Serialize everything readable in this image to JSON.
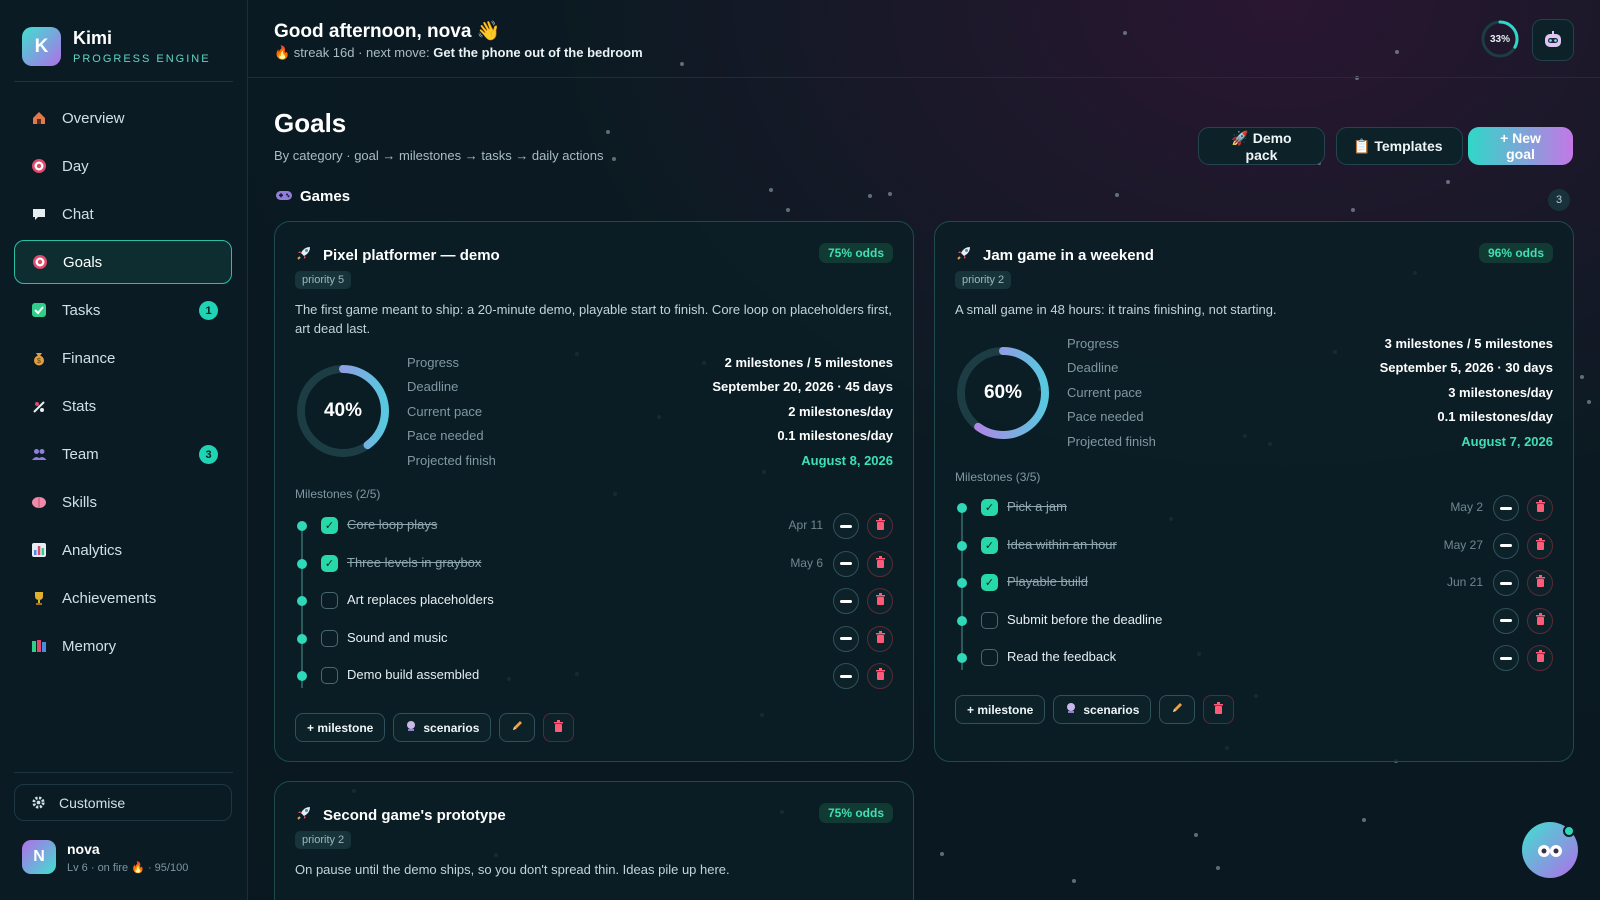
{
  "brand": {
    "logo_letter": "K",
    "name": "Kimi",
    "tagline": "PROGRESS ENGINE"
  },
  "nav": [
    {
      "label": "Overview",
      "icon": "home-icon",
      "badge": null,
      "active": false
    },
    {
      "label": "Day",
      "icon": "target-icon",
      "badge": null,
      "active": false
    },
    {
      "label": "Chat",
      "icon": "chat-bubble-icon",
      "badge": null,
      "active": false
    },
    {
      "label": "Goals",
      "icon": "target-icon",
      "badge": null,
      "active": true
    },
    {
      "label": "Tasks",
      "icon": "checkbox-icon",
      "badge": "1",
      "active": false
    },
    {
      "label": "Finance",
      "icon": "money-bag-icon",
      "badge": null,
      "active": false
    },
    {
      "label": "Stats",
      "icon": "stats-icon",
      "badge": null,
      "active": false
    },
    {
      "label": "Team",
      "icon": "people-icon",
      "badge": "3",
      "active": false
    },
    {
      "label": "Skills",
      "icon": "brain-icon",
      "badge": null,
      "active": false
    },
    {
      "label": "Analytics",
      "icon": "bar-chart-icon",
      "badge": null,
      "active": false
    },
    {
      "label": "Achievements",
      "icon": "trophy-icon",
      "badge": null,
      "active": false
    },
    {
      "label": "Memory",
      "icon": "books-icon",
      "badge": null,
      "active": false
    }
  ],
  "customise": {
    "label": "Customise"
  },
  "user": {
    "initial": "N",
    "name": "nova",
    "subtitle": "Lv 6 · on fire 🔥 · 95/100"
  },
  "header": {
    "greeting": "Good afternoon, nova 👋",
    "streak_prefix": "🔥 streak 16d · next move: ",
    "next_move": "Get the phone out of the bedroom",
    "day_progress": 33,
    "day_progress_label": "33%"
  },
  "page": {
    "title": "Goals",
    "subtitle": "By category · goal → milestones → tasks → daily actions",
    "buttons": {
      "demo_pack": "🚀 Demo pack",
      "templates": "📋 Templates",
      "new_goal": "+ New goal"
    }
  },
  "category": {
    "icon": "gamepad-icon",
    "name": "Games",
    "count": "3"
  },
  "stat_labels": [
    "Progress",
    "Deadline",
    "Current pace",
    "Pace needed",
    "Projected finish"
  ],
  "card_actions": {
    "add_milestone": "+ milestone",
    "scenarios": "scenarios"
  },
  "goals": [
    {
      "title": "Pixel platformer — demo",
      "odds": "75% odds",
      "priority": "priority 5",
      "description": "The first game meant to ship: a 20-minute demo, playable start to finish. Core loop on placeholders first, art dead last.",
      "percent": 40,
      "percent_label": "40%",
      "stats": [
        "2 milestones / 5 milestones",
        "September 20, 2026 · 45 days",
        "2 milestones/day",
        "0.1 milestones/day",
        "August 8, 2026"
      ],
      "milestones_head": "Milestones (2/5)",
      "milestones": [
        {
          "label": "Core loop plays",
          "done": true,
          "date": "Apr 11"
        },
        {
          "label": "Three levels in graybox",
          "done": true,
          "date": "May 6"
        },
        {
          "label": "Art replaces placeholders",
          "done": false,
          "date": ""
        },
        {
          "label": "Sound and music",
          "done": false,
          "date": ""
        },
        {
          "label": "Demo build assembled",
          "done": false,
          "date": ""
        }
      ]
    },
    {
      "title": "Jam game in a weekend",
      "odds": "96% odds",
      "priority": "priority 2",
      "description": "A small game in 48 hours: it trains finishing, not starting.",
      "percent": 60,
      "percent_label": "60%",
      "stats": [
        "3 milestones / 5 milestones",
        "September 5, 2026 · 30 days",
        "3 milestones/day",
        "0.1 milestones/day",
        "August 7, 2026"
      ],
      "milestones_head": "Milestones (3/5)",
      "milestones": [
        {
          "label": "Pick a jam",
          "done": true,
          "date": "May 2"
        },
        {
          "label": "Idea within an hour",
          "done": true,
          "date": "May 27"
        },
        {
          "label": "Playable build",
          "done": true,
          "date": "Jun 21"
        },
        {
          "label": "Submit before the deadline",
          "done": false,
          "date": ""
        },
        {
          "label": "Read the feedback",
          "done": false,
          "date": ""
        }
      ]
    },
    {
      "title": "Second game's prototype",
      "odds": "75% odds",
      "priority": "priority 2",
      "description": "On pause until the demo ships, so you don't spread thin. Ideas pile up here."
    }
  ],
  "colors": {
    "accent_teal": "#2fd8b8",
    "accent_purple": "#c477e6",
    "danger": "#e0506a",
    "good": "#3fe0b5"
  }
}
